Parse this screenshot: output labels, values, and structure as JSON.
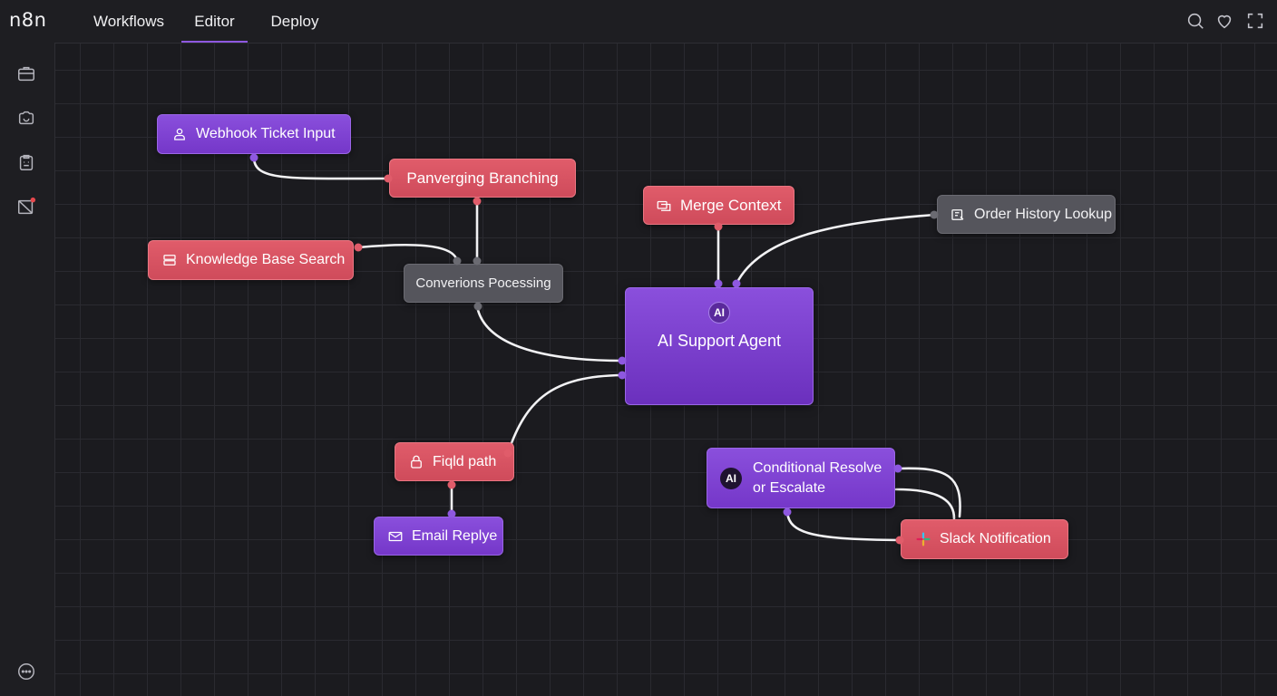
{
  "app": {
    "logo": "n8n"
  },
  "tabs": [
    {
      "label": "Workflows",
      "active": false
    },
    {
      "label": "Editor",
      "active": true
    },
    {
      "label": "Deploy",
      "active": false
    }
  ],
  "sidebar": {
    "icons": [
      "briefcase-icon",
      "camera-flow-icon",
      "clipboard-icon",
      "notification-icon"
    ],
    "bottom_icon": "more-icon"
  },
  "toolbar": {
    "icons": [
      "search-icon",
      "heart-icon",
      "expand-icon"
    ]
  },
  "nodes": {
    "webhook": "Webhook Ticket Input",
    "branching": "Panverging Branching",
    "knowledge": "Knowledge Base Search",
    "conversions": "Converions Pocessing",
    "merge": "Merge Context",
    "order": "Order History Lookup",
    "agent_badge": "AI",
    "agent": "AI Support Agent",
    "field": "Fiqld path",
    "email": "Email Replye",
    "cond_badge": "AI",
    "cond_line1": "Conditional Resolve",
    "cond_line2": "or Escalate",
    "slack": "Slack Notification"
  },
  "colors": {
    "accent": "#8e58e0",
    "node_purple": "#7f44d4",
    "node_red": "#d9505f",
    "node_gray": "#55555c",
    "notification_dot": "#e5484d"
  }
}
